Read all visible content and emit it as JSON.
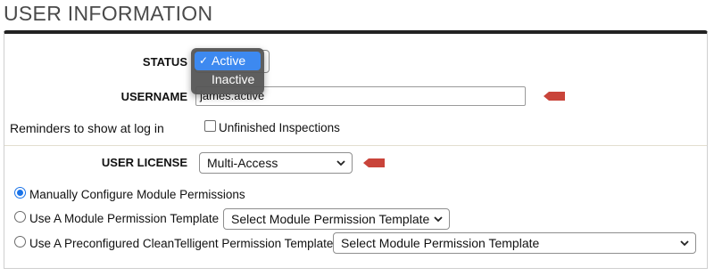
{
  "page": {
    "title": "USER INFORMATION"
  },
  "form": {
    "status": {
      "label": "STATUS",
      "options": [
        "Active",
        "Inactive"
      ],
      "selected": "Active"
    },
    "username": {
      "label": "USERNAME",
      "value": "james.active"
    },
    "reminders": {
      "label": "Reminders to show at log in",
      "checkbox_label": "Unfinished Inspections",
      "checked": false
    },
    "user_license": {
      "label": "USER LICENSE",
      "selected": "Multi-Access"
    },
    "permissions": {
      "manual": {
        "label": "Manually Configure Module Permissions",
        "checked": true
      },
      "template": {
        "label": "Use A Module Permission Template",
        "checked": false,
        "select_value": "Select Module Permission Template"
      },
      "preconfigured": {
        "label": "Use A Preconfigured CleanTelligent Permission Template",
        "checked": false,
        "select_value": "Select Module Permission Template"
      }
    }
  },
  "colors": {
    "pointer_red": "#c9443a",
    "selected_blue": "#3d89f0",
    "radio_blue": "#1a73e8"
  },
  "icons": {
    "required_indicator": "pointer-arrow-icon",
    "select_chevron": "chevron-down-icon",
    "selected_check": "checkmark-icon"
  }
}
